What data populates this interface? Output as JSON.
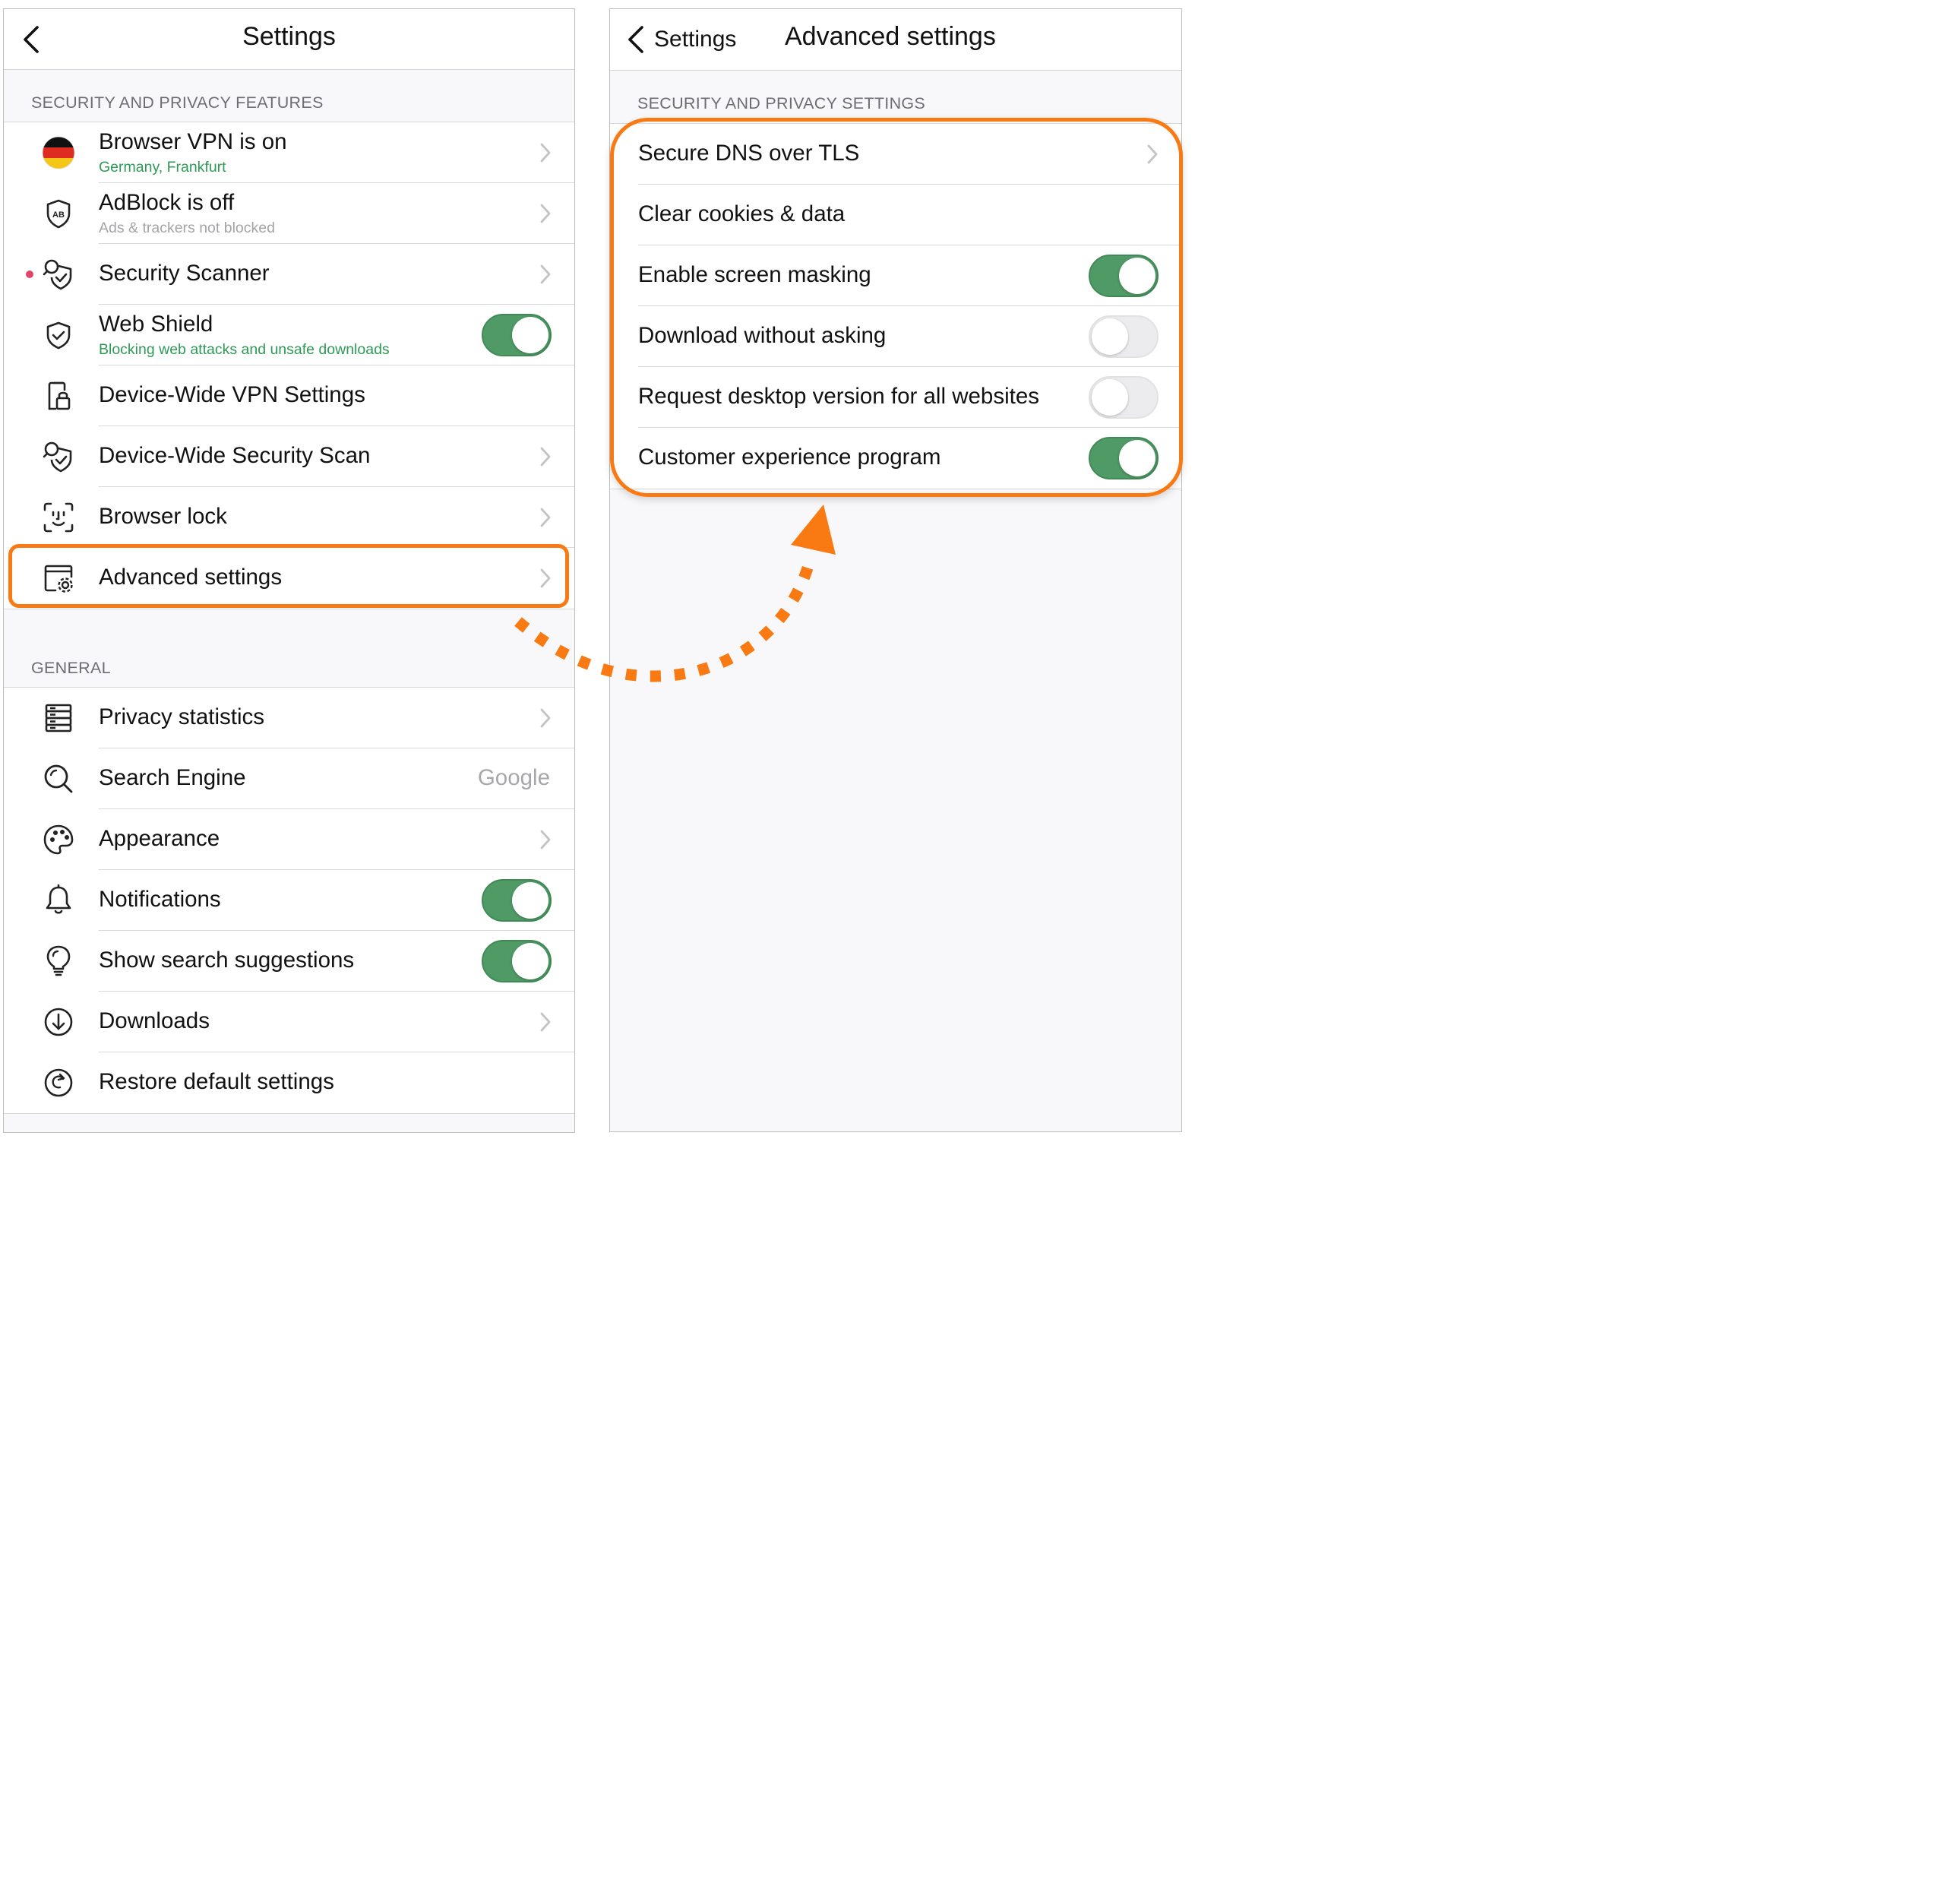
{
  "colors": {
    "accent_orange": "#f97a12",
    "toggle_on": "#4f9a65",
    "toggle_off": "#ececee",
    "status_green": "#2e9a56",
    "security_dot": "#e0466a"
  },
  "left": {
    "navbar": {
      "title": "Settings",
      "back_icon": "chevron-left-icon"
    },
    "security_section": {
      "header": "SECURITY AND PRIVACY FEATURES",
      "items": [
        {
          "label": "Browser VPN is on",
          "sublabel": "Germany, Frankfurt",
          "icon": "germany-flag-icon",
          "accessory": "chevron"
        },
        {
          "label": "AdBlock is off",
          "sublabel": "Ads & trackers not blocked",
          "icon": "adblock-shield-icon",
          "accessory": "chevron"
        },
        {
          "label": "Security Scanner",
          "icon": "security-scanner-icon",
          "accessory": "chevron",
          "indicator": "red-dot"
        },
        {
          "label": "Web Shield",
          "sublabel": "Blocking web attacks and unsafe downloads",
          "icon": "shield-check-icon",
          "accessory": "toggle",
          "toggle_on": true
        },
        {
          "label": "Device-Wide VPN Settings",
          "icon": "device-lock-icon",
          "accessory": "none"
        },
        {
          "label": "Device-Wide Security Scan",
          "icon": "security-scanner-icon",
          "accessory": "chevron"
        },
        {
          "label": "Browser lock",
          "icon": "face-id-icon",
          "accessory": "chevron"
        },
        {
          "label": "Advanced settings",
          "icon": "settings-gear-icon",
          "accessory": "chevron",
          "highlighted": true
        }
      ]
    },
    "general_section": {
      "header": "GENERAL",
      "items": [
        {
          "label": "Privacy statistics",
          "icon": "database-icon",
          "accessory": "chevron"
        },
        {
          "label": "Search Engine",
          "icon": "search-icon",
          "accessory": "value",
          "value": "Google"
        },
        {
          "label": "Appearance",
          "icon": "palette-icon",
          "accessory": "chevron"
        },
        {
          "label": "Notifications",
          "icon": "bell-icon",
          "accessory": "toggle",
          "toggle_on": true
        },
        {
          "label": "Show search suggestions",
          "icon": "lightbulb-icon",
          "accessory": "toggle",
          "toggle_on": true
        },
        {
          "label": "Downloads",
          "icon": "download-icon",
          "accessory": "chevron"
        },
        {
          "label": "Restore default settings",
          "icon": "restore-icon",
          "accessory": "none"
        }
      ]
    }
  },
  "right": {
    "navbar": {
      "back_label": "Settings",
      "title": "Advanced settings",
      "back_icon": "chevron-left-icon"
    },
    "section": {
      "header": "SECURITY AND PRIVACY SETTINGS",
      "items": [
        {
          "label": "Secure DNS over TLS",
          "accessory": "chevron"
        },
        {
          "label": "Clear cookies & data",
          "accessory": "none"
        },
        {
          "label": "Enable screen masking",
          "accessory": "toggle",
          "toggle_on": true
        },
        {
          "label": "Download without asking",
          "accessory": "toggle",
          "toggle_on": false
        },
        {
          "label": "Request desktop version for all websites",
          "accessory": "toggle",
          "toggle_on": false
        },
        {
          "label": "Customer experience program",
          "accessory": "toggle",
          "toggle_on": true
        }
      ]
    }
  }
}
